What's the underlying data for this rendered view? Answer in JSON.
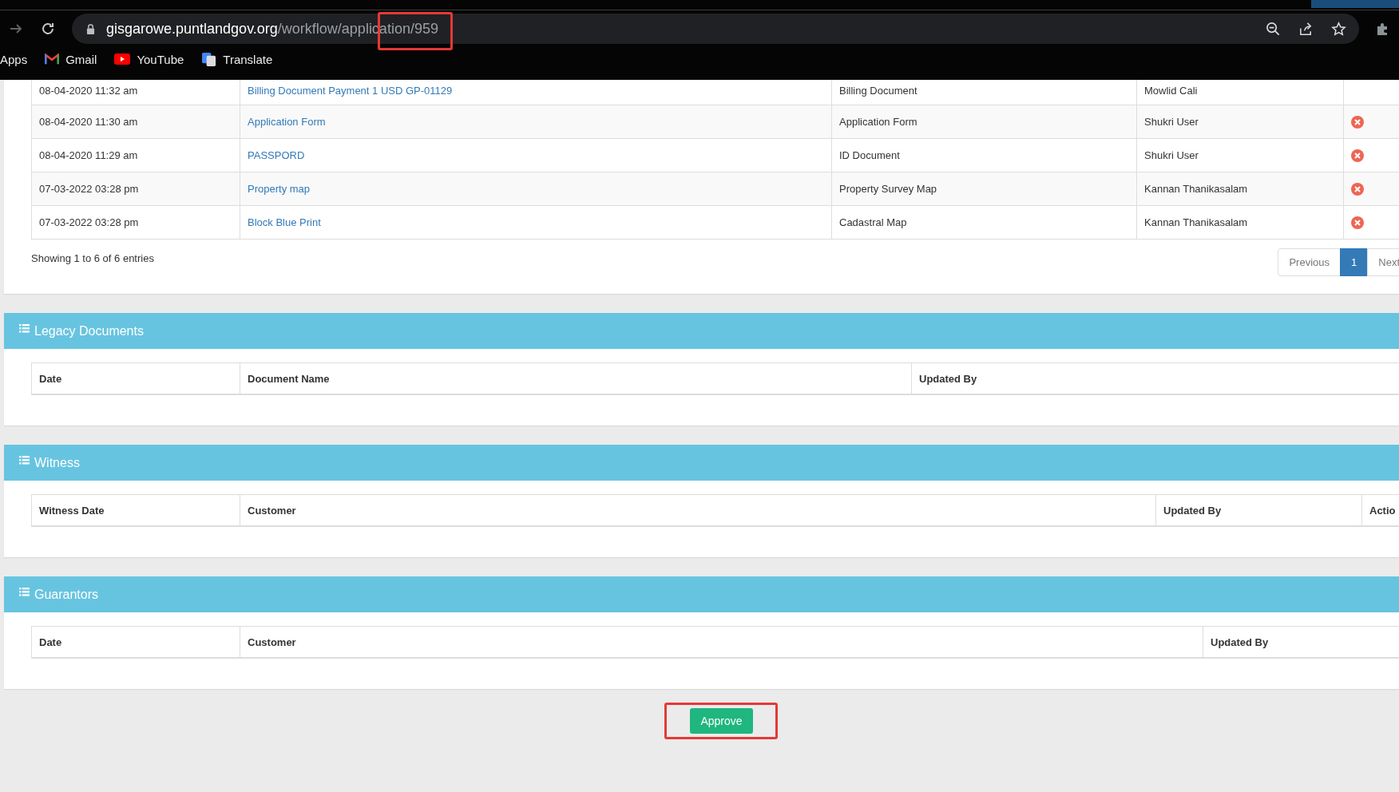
{
  "browser": {
    "url_host": "gisgarowe.puntlandgov.org",
    "url_path": "/workflow/application/959",
    "bookmarks": [
      {
        "label": "Apps",
        "kind": "apps"
      },
      {
        "label": "Gmail",
        "kind": "mail"
      },
      {
        "label": "YouTube",
        "kind": "video"
      },
      {
        "label": "Translate",
        "kind": "translate"
      }
    ]
  },
  "documents": {
    "rows": [
      {
        "date": "08-04-2020 11:32 am",
        "name": "Billing Document Payment 1 USD GP-01129",
        "type": "Billing Document",
        "updated_by": "Mowlid Cali",
        "deletable": false
      },
      {
        "date": "08-04-2020 11:30 am",
        "name": "Application Form",
        "type": "Application Form",
        "updated_by": "Shukri User",
        "deletable": true
      },
      {
        "date": "08-04-2020 11:29 am",
        "name": "PASSPORD",
        "type": "ID Document",
        "updated_by": "Shukri User",
        "deletable": true
      },
      {
        "date": "07-03-2022 03:28 pm",
        "name": "Property map",
        "type": "Property Survey Map",
        "updated_by": "Kannan Thanikasalam",
        "deletable": true
      },
      {
        "date": "07-03-2022 03:28 pm",
        "name": "Block Blue Print",
        "type": "Cadastral Map",
        "updated_by": "Kannan Thanikasalam",
        "deletable": true
      }
    ],
    "info": "Showing 1 to 6 of 6 entries",
    "pagination": [
      {
        "label": "Previous",
        "selected": false
      },
      {
        "label": "1",
        "selected": true
      },
      {
        "label": "Next",
        "selected": false
      }
    ]
  },
  "sections": [
    {
      "title": "Legacy Documents",
      "columns": [
        "Date",
        "Document Name",
        "Updated By"
      ]
    },
    {
      "title": "Witness",
      "columns": [
        "Witness Date",
        "Customer",
        "Updated By",
        "Actio"
      ]
    },
    {
      "title": "Guarantors",
      "columns": [
        "Date",
        "Customer",
        "Updated By"
      ]
    }
  ],
  "approve_button": "Approve"
}
